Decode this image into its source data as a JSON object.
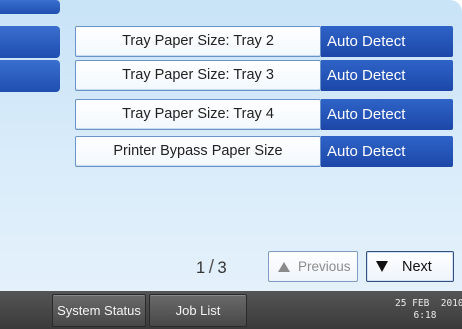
{
  "settings": [
    {
      "label": "Tray Paper Size: Tray 2",
      "value": "Auto Detect"
    },
    {
      "label": "Tray Paper Size: Tray 3",
      "value": "Auto Detect"
    },
    {
      "label": "Tray Paper Size: Tray 4",
      "value": "Auto Detect"
    },
    {
      "label": "Printer Bypass Paper Size",
      "value": "Auto Detect"
    }
  ],
  "pagination": {
    "current": "1",
    "separator": "/",
    "total": "3",
    "previous_label": "Previous",
    "next_label": "Next",
    "previous_enabled": false
  },
  "statusbar": {
    "system_status_label": "System Status",
    "job_list_label": "Job List",
    "date": "25 FEB  2010",
    "time": "6:18"
  },
  "colors": {
    "accent_blue": "#1f4fb0",
    "panel_bg": "#d5eaf8",
    "status_bar": "#444444"
  },
  "icons": {
    "previous": "triangle-up-icon",
    "next": "triangle-down-icon"
  }
}
